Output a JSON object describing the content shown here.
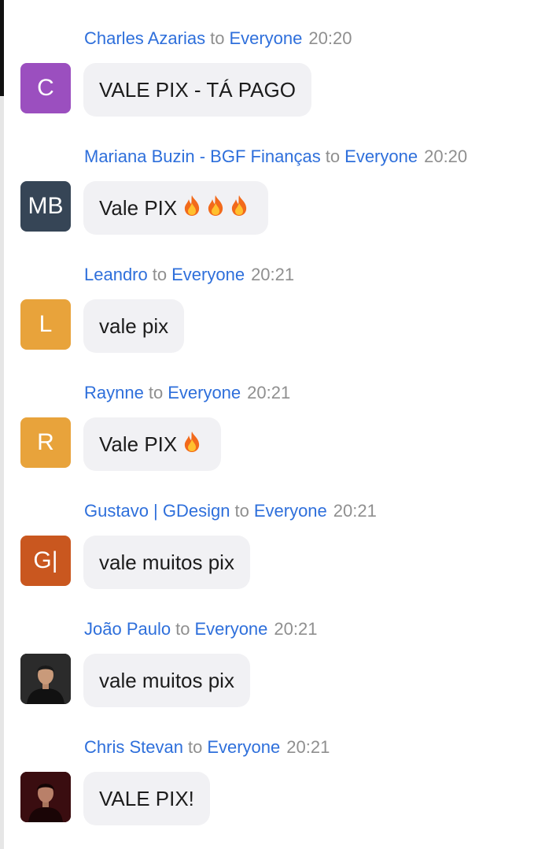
{
  "messages": [
    {
      "sender": "Charles Azarias",
      "to_word": "to",
      "recipient": "Everyone",
      "time": "20:20",
      "avatar_text": "C",
      "avatar_color": "#9b4fbf",
      "text": "VALE PIX - TÁ PAGO",
      "emoji_count": 0
    },
    {
      "sender": "Mariana Buzin - BGF Finanças",
      "to_word": "to",
      "recipient": "Everyone",
      "time": "20:20",
      "avatar_text": "MB",
      "avatar_color": "#364556",
      "text": "Vale PIX",
      "emoji_count": 3
    },
    {
      "sender": "Leandro",
      "to_word": "to",
      "recipient": "Everyone",
      "time": "20:21",
      "avatar_text": "L",
      "avatar_color": "#e8a33b",
      "text": "vale pix",
      "emoji_count": 0
    },
    {
      "sender": "Raynne",
      "to_word": "to",
      "recipient": "Everyone",
      "time": "20:21",
      "avatar_text": "R",
      "avatar_color": "#e8a33b",
      "text": "Vale PIX",
      "emoji_count": 1
    },
    {
      "sender": "Gustavo | GDesign",
      "to_word": "to",
      "recipient": "Everyone",
      "time": "20:21",
      "avatar_text": "G|",
      "avatar_color": "#c9571f",
      "text": "vale muitos pix",
      "emoji_count": 0
    },
    {
      "sender": "João Paulo",
      "to_word": "to",
      "recipient": "Everyone",
      "time": "20:21",
      "avatar_text": "",
      "avatar_color": "#2a2a2a",
      "text": "vale muitos pix",
      "emoji_count": 0
    },
    {
      "sender": "Chris Stevan",
      "to_word": "to",
      "recipient": "Everyone",
      "time": "20:21",
      "avatar_text": "",
      "avatar_color": "#3a0d10",
      "text": "VALE PIX!",
      "emoji_count": 0
    }
  ],
  "icons": {
    "emoji": "fire-emoji-icon",
    "photo": "person-photo-icon"
  },
  "colors": {
    "link": "#2e6fdb",
    "muted": "#8f8f8f",
    "bubble": "#f1f1f4"
  }
}
